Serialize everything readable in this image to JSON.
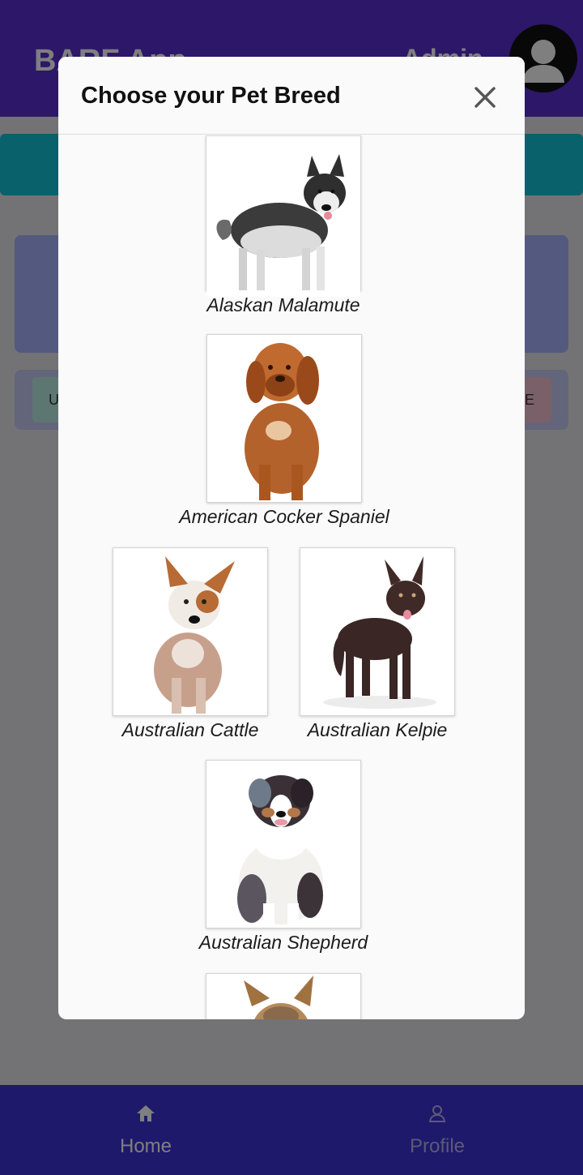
{
  "app": {
    "title": "BARF App",
    "user": "Admin",
    "card_left_label": "U",
    "card_right_label": "E"
  },
  "modal": {
    "title": "Choose your Pet Breed"
  },
  "breeds": [
    {
      "name": "Alaskan Malamute",
      "icon": "malamute-dog"
    },
    {
      "name": "American Cocker Spaniel",
      "icon": "mastiff-dog"
    },
    {
      "name": "Australian Cattle",
      "icon": "cattle-dog"
    },
    {
      "name": "Australian Kelpie",
      "icon": "kelpie-dog"
    },
    {
      "name": "Australian Shepherd",
      "icon": "shepherd-dog"
    },
    {
      "name": "",
      "icon": "yorkie-dog"
    }
  ],
  "nav": {
    "home_label": "Home",
    "profile_label": "Profile"
  },
  "colors": {
    "header": "#5a2fd0",
    "accent_teal": "#11c3d6",
    "bottom_nav": "#3e32d6"
  }
}
